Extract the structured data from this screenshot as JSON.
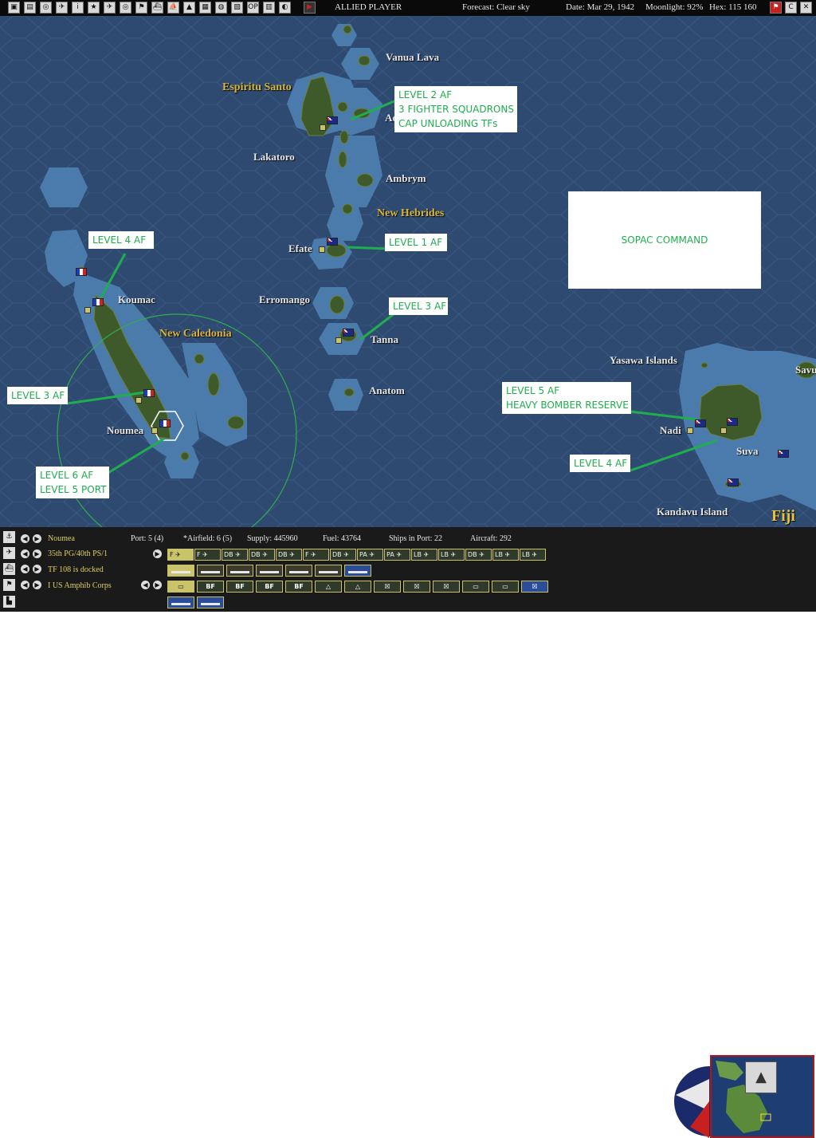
{
  "topbar": {
    "player": "ALLIED PLAYER",
    "forecast": "Forecast: Clear sky",
    "date": "Date: Mar 29, 1942",
    "moonlight": "Moonlight: 92%",
    "hex": "Hex: 115 160",
    "icons": [
      "menu-icon",
      "report-icon",
      "intel-icon",
      "air-icon",
      "info-icon",
      "medal-icon",
      "aircraft-icon",
      "target-icon",
      "flag-icon",
      "plane-icon",
      "ship-icon",
      "land-icon",
      "tf-icon",
      "globe-icon",
      "map-icon",
      "op-icon",
      "list-icon",
      "moon-icon",
      "end-turn-icon"
    ],
    "right_icons": [
      "flag-icon",
      "c-icon",
      "close-icon"
    ]
  },
  "map": {
    "labels": {
      "vanua_lava": "Vanua Lava",
      "espiritu_santo": "Espiritu Santo",
      "ao": "Ao",
      "lakatoro": "Lakatoro",
      "ambrym": "Ambrym",
      "new_hebrides": "New Hebrides",
      "efate": "Efate",
      "koumac": "Koumac",
      "erromango": "Erromango",
      "tanna": "Tanna",
      "new_caledonia": "New Caledonia",
      "noumea": "Noumea",
      "anatom": "Anatom",
      "yasawa": "Yasawa Islands",
      "savu": "Savu",
      "nadi": "Nadi",
      "suva": "Suva",
      "kandavu": "Kandavu Island",
      "fiji": "Fiji"
    },
    "annotations": {
      "espiritu": [
        "LEVEL 2 AF",
        "3 FIGHTER SQUADRONS",
        "CAP UNLOADING TFs"
      ],
      "efate": [
        "LEVEL 1 AF"
      ],
      "koumac": [
        "LEVEL 4 AF"
      ],
      "tanna": [
        "LEVEL 3 AF"
      ],
      "nc_mid": [
        "LEVEL 3 AF"
      ],
      "noumea": [
        "LEVEL 6 AF",
        "LEVEL 5 PORT"
      ],
      "nadi": [
        "LEVEL 5 AF",
        "HEAVY BOMBER RESERVE"
      ],
      "suva": [
        "LEVEL 4 AF"
      ]
    },
    "sopac": "SOPAC COMMAND"
  },
  "panel": {
    "base_name": "Noumea",
    "port": "Port: 5 (4)",
    "airfield": "*Airfield: 6 (5)",
    "supply": "Supply: 445960",
    "fuel": "Fuel: 43764",
    "ships_in_port": "Ships in Port: 22",
    "aircraft": "Aircraft: 292",
    "air_group": "35th PG/40th PS/1",
    "task_force": "TF 108 is docked",
    "land_unit": "I US Amphib Corps",
    "air_units": [
      "F",
      "F",
      "DB",
      "DB",
      "DB",
      "F",
      "DB",
      "PA",
      "PA",
      "LB",
      "LB",
      "DB",
      "LB",
      "LB"
    ],
    "ground_units": [
      "BF",
      "BF",
      "BF",
      "BF"
    ]
  },
  "colors": {
    "ocean": "#2e4a70",
    "annotation_text": "#1fae4e",
    "label_gold": "#d9b43a",
    "range_circle": "#2fae4e"
  }
}
